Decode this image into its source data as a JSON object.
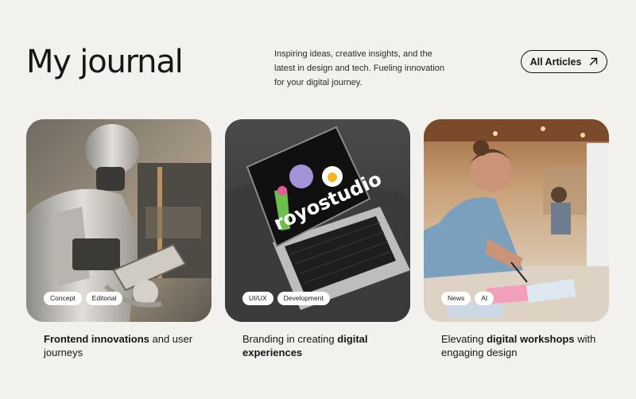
{
  "header": {
    "title": "My journal",
    "intro": "Inspiring ideas, creative insights, and the latest in design and tech. Fueling innovation for your digital journey.",
    "all_articles_label": "All Articles",
    "all_articles_icon": "arrow-up-right-icon"
  },
  "cards": [
    {
      "tags": [
        "Concept",
        "Editorial"
      ],
      "caption_bold_1": "Frontend innovations",
      "caption_text_1": " and user journeys",
      "image": "robot-holding-tablet"
    },
    {
      "tags": [
        "UI/UX",
        "Development"
      ],
      "caption_text_1": "Branding in creating ",
      "caption_bold_1": "digital experiences",
      "image": "laptop-royostudio",
      "laptop_text": "royostudio"
    },
    {
      "tags": [
        "News",
        "AI"
      ],
      "caption_text_1": "Elevating ",
      "caption_bold_1": "digital workshops",
      "caption_text_2": " with engaging design",
      "image": "woman-writing-in-office"
    }
  ],
  "colors": {
    "background": "#f3f1ee",
    "text": "#161616",
    "tag_background": "#ffffff"
  }
}
